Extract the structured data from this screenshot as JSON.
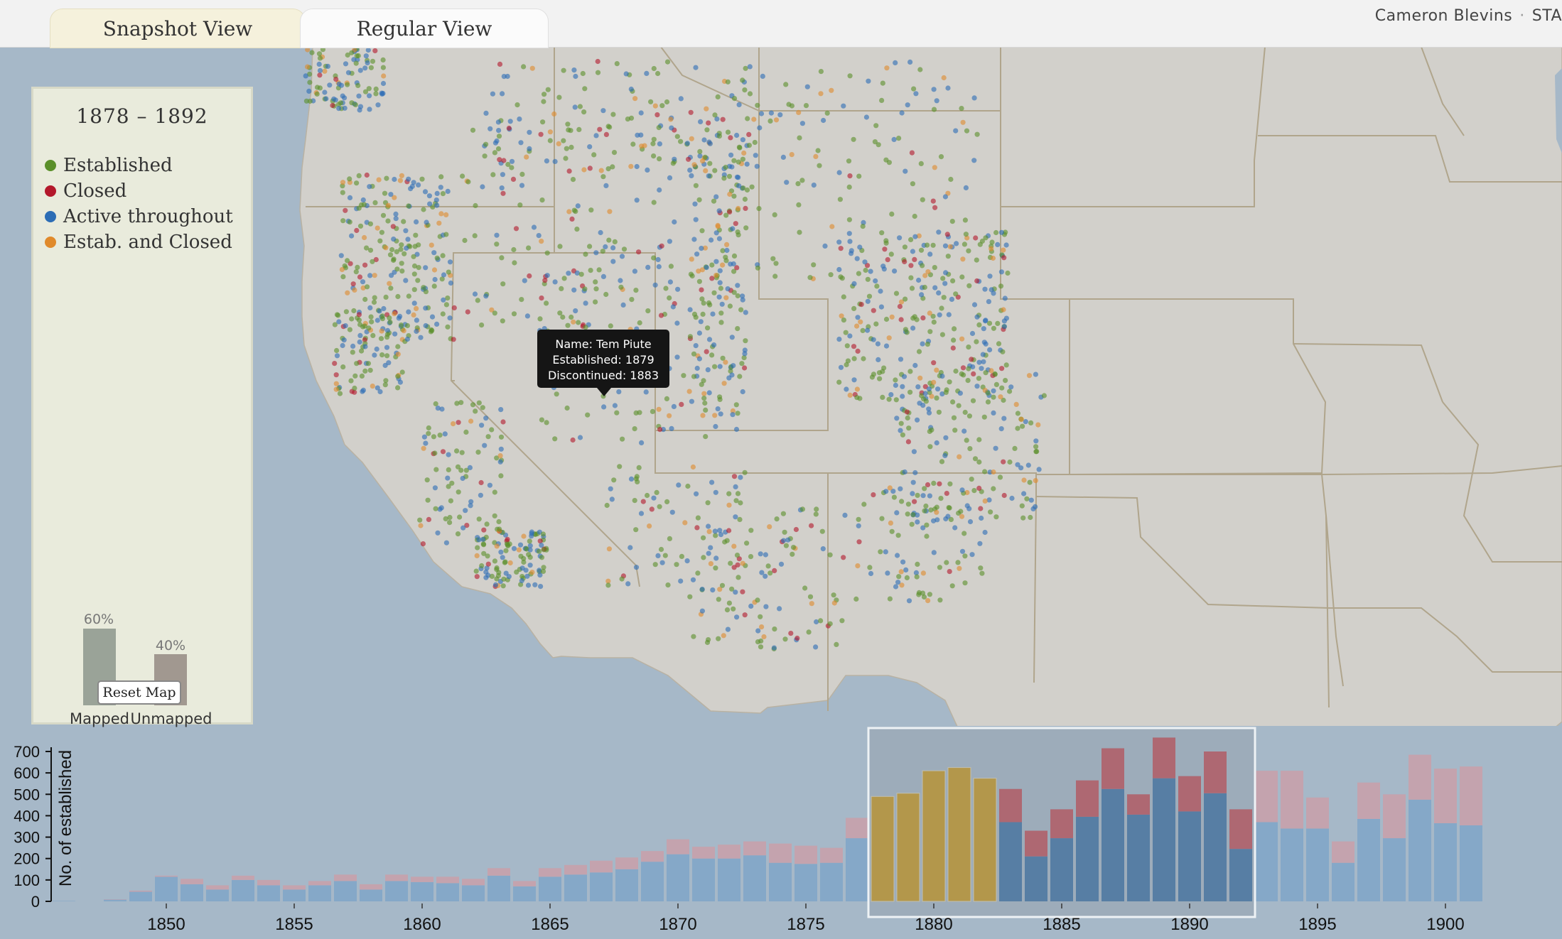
{
  "tabs": [
    {
      "label": "Snapshot View",
      "active": true
    },
    {
      "label": "Regular View",
      "active": false
    }
  ],
  "author": {
    "name": "Cameron Blevins",
    "extra": "STA"
  },
  "panel": {
    "title": "1878 – 1892",
    "legend": [
      {
        "label": "Established",
        "color": "#5a8f29"
      },
      {
        "label": "Closed",
        "color": "#b3182b"
      },
      {
        "label": "Active throughout",
        "color": "#2c6db5"
      },
      {
        "label": "Estab. and Closed",
        "color": "#e08a2b"
      }
    ],
    "mapped": {
      "label": "Mapped",
      "percent_text": "60%",
      "fraction": 0.6,
      "color": "#9aa398"
    },
    "unmapped": {
      "label": "Unmapped",
      "percent_text": "40%",
      "fraction": 0.4,
      "color": "#a19890"
    },
    "reset_label": "Reset Map"
  },
  "tooltip": {
    "name": "Name: Tem Piute",
    "established": "Established: 1879",
    "discontinued": "Discontinued: 1883"
  },
  "chart_data": {
    "type": "bar",
    "ylabel": "No. of established",
    "ylim": [
      0,
      720
    ],
    "y_ticks": [
      0,
      100,
      200,
      300,
      400,
      500,
      600,
      700
    ],
    "x_ticks": [
      1850,
      1855,
      1860,
      1865,
      1870,
      1875,
      1880,
      1885,
      1890,
      1895,
      1900
    ],
    "selection": [
      1878,
      1892
    ],
    "colors": {
      "active": "#3b72a6",
      "closed": "#c0505a",
      "estab_closed": "#c8981e",
      "faded_blue": "#85a8c8",
      "faded_red": "#c4a3ae"
    },
    "categories": [
      1846,
      1847,
      1848,
      1849,
      1850,
      1851,
      1852,
      1853,
      1854,
      1855,
      1856,
      1857,
      1858,
      1859,
      1860,
      1861,
      1862,
      1863,
      1864,
      1865,
      1866,
      1867,
      1868,
      1869,
      1870,
      1871,
      1872,
      1873,
      1874,
      1875,
      1876,
      1877,
      1878,
      1879,
      1880,
      1881,
      1882,
      1883,
      1884,
      1885,
      1886,
      1887,
      1888,
      1889,
      1890,
      1891,
      1892,
      1893,
      1894,
      1895,
      1896,
      1897,
      1898,
      1899,
      1900,
      1901,
      1902
    ],
    "series": [
      {
        "name": "Active",
        "values": [
          2,
          0,
          8,
          45,
          115,
          80,
          55,
          100,
          75,
          55,
          75,
          95,
          55,
          95,
          90,
          85,
          75,
          120,
          70,
          115,
          125,
          135,
          150,
          185,
          220,
          200,
          200,
          215,
          180,
          175,
          180,
          295,
          0,
          0,
          0,
          0,
          0,
          370,
          210,
          295,
          395,
          525,
          405,
          575,
          420,
          505,
          245,
          370,
          340,
          340,
          180,
          385,
          295,
          475,
          365,
          355
        ]
      },
      {
        "name": "Closed",
        "values": [
          0,
          0,
          2,
          5,
          5,
          25,
          20,
          20,
          25,
          20,
          20,
          30,
          25,
          30,
          25,
          30,
          30,
          35,
          25,
          40,
          45,
          55,
          55,
          50,
          70,
          55,
          65,
          65,
          90,
          85,
          70,
          95,
          0,
          0,
          0,
          0,
          0,
          155,
          120,
          135,
          170,
          190,
          95,
          190,
          165,
          195,
          185,
          240,
          270,
          145,
          100,
          170,
          205,
          210,
          255,
          275
        ]
      },
      {
        "name": "Estab. and Closed",
        "values": [
          0,
          0,
          0,
          0,
          0,
          0,
          0,
          0,
          0,
          0,
          0,
          0,
          0,
          0,
          0,
          0,
          0,
          0,
          0,
          0,
          0,
          0,
          0,
          0,
          0,
          0,
          0,
          0,
          0,
          0,
          0,
          0,
          490,
          505,
          610,
          625,
          575,
          0,
          0,
          0,
          0,
          0,
          0,
          0,
          0,
          0,
          0,
          0,
          0,
          0,
          0,
          0,
          0,
          0,
          0,
          0
        ]
      }
    ]
  }
}
